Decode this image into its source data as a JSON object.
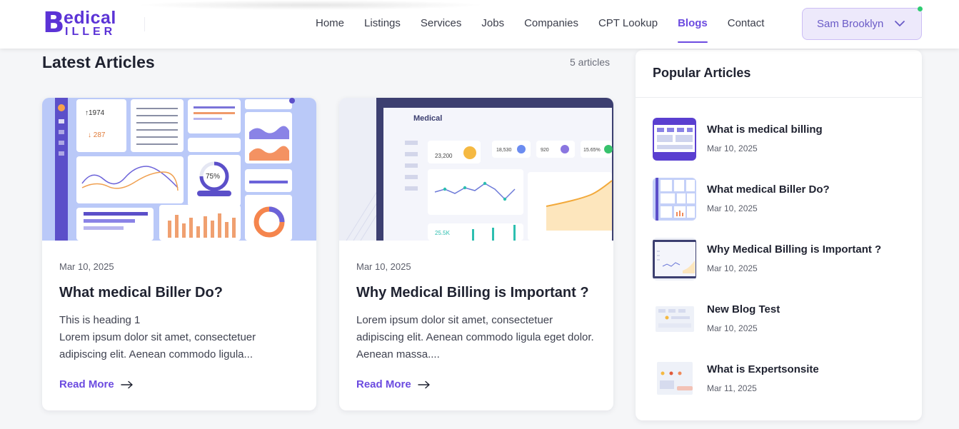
{
  "header": {
    "logo": {
      "mark": "B",
      "line1": "edical",
      "line2": "ILLER"
    },
    "nav": [
      {
        "label": "Home",
        "active": false
      },
      {
        "label": "Listings",
        "active": false
      },
      {
        "label": "Services",
        "active": false
      },
      {
        "label": "Jobs",
        "active": false
      },
      {
        "label": "Companies",
        "active": false
      },
      {
        "label": "CPT Lookup",
        "active": false
      },
      {
        "label": "Blogs",
        "active": true
      },
      {
        "label": "Contact",
        "active": false
      }
    ],
    "user": {
      "name": "Sam Brooklyn",
      "icon": "chevron-down-icon",
      "status": "online"
    }
  },
  "main": {
    "title": "Latest Articles",
    "count": "5 articles",
    "cards": [
      {
        "date": "Mar 10, 2025",
        "title": "What medical Biller Do?",
        "excerpt": [
          "This is heading 1",
          "Lorem ipsum dolor sit amet, consectetuer",
          "adipiscing elit. Aenean commodo ligula..."
        ],
        "read_more": "Read More",
        "image": "dashboard-illustration"
      },
      {
        "date": "Mar 10, 2025",
        "title": "Why Medical Billing is Important ?",
        "excerpt": [
          "Lorem ipsum dolor sit amet, consectetuer",
          "adipiscing elit. Aenean commodo ligula eget dolor.",
          "Aenean massa...."
        ],
        "read_more": "Read More",
        "image": "laptop-dashboard-illustration",
        "image_logo": "Medical",
        "image_stats": [
          "23,200",
          "18,530",
          "920",
          "15.65%",
          "25.5K"
        ]
      }
    ]
  },
  "sidebar": {
    "title": "Popular Articles",
    "items": [
      {
        "title": "What is medical billing",
        "date": "Mar 10, 2025"
      },
      {
        "title": "What medical Biller Do?",
        "date": "Mar 10, 2025"
      },
      {
        "title": "Why Medical Billing is Important ?",
        "date": "Mar 10, 2025"
      },
      {
        "title": "New Blog Test",
        "date": "Mar 10, 2025"
      },
      {
        "title": "What is Expertsonsite",
        "date": "Mar 11, 2025"
      }
    ]
  },
  "colors": {
    "accent": "#6c4be0",
    "brand": "#5b33d6",
    "online": "#2ecc71"
  }
}
